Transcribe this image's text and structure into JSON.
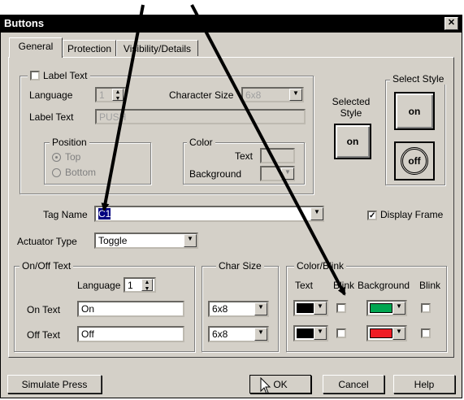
{
  "window": {
    "title": "Buttons",
    "close_glyph": "✕"
  },
  "tabs": [
    {
      "label": "General"
    },
    {
      "label": "Protection"
    },
    {
      "label": "Visibility/Details"
    }
  ],
  "label_text": {
    "checkbox_label": "Label Text",
    "checked": false,
    "language_label": "Language",
    "language_value": "1",
    "char_size_label": "Character Size",
    "char_size_value": "6x8",
    "label_text_label": "Label Text",
    "label_text_value": "PUSH",
    "position_legend": "Position",
    "position_top": "Top",
    "position_bottom": "Bottom",
    "color_legend": "Color",
    "color_text": "Text",
    "color_background": "Background"
  },
  "styles": {
    "selected_style_label": "Selected Style",
    "select_style_legend": "Select Style",
    "on_label": "on",
    "off_label": "off"
  },
  "tag_name": {
    "label": "Tag Name",
    "value": "C1"
  },
  "display_frame": {
    "label": "Display Frame",
    "checked": true
  },
  "actuator": {
    "label": "Actuator Type",
    "value": "Toggle"
  },
  "on_off_text": {
    "legend": "On/Off Text",
    "language_label": "Language",
    "language_value": "1",
    "on_label": "On Text",
    "on_value": "On",
    "off_label": "Off Text",
    "off_value": "Off"
  },
  "char_size": {
    "legend": "Char Size",
    "on_value": "6x8",
    "off_value": "6x8"
  },
  "color_blink": {
    "legend": "Color/Blink",
    "text_header": "Text",
    "blink_header": "Blink",
    "background_header": "Background",
    "blink2_header": "Blink",
    "on_text_color": "#000000",
    "on_bg_color": "#00a651",
    "off_text_color": "#000000",
    "off_bg_color": "#ee1c25"
  },
  "buttons": {
    "simulate": "Simulate Press",
    "ok": "OK",
    "cancel": "Cancel",
    "help": "Help"
  }
}
